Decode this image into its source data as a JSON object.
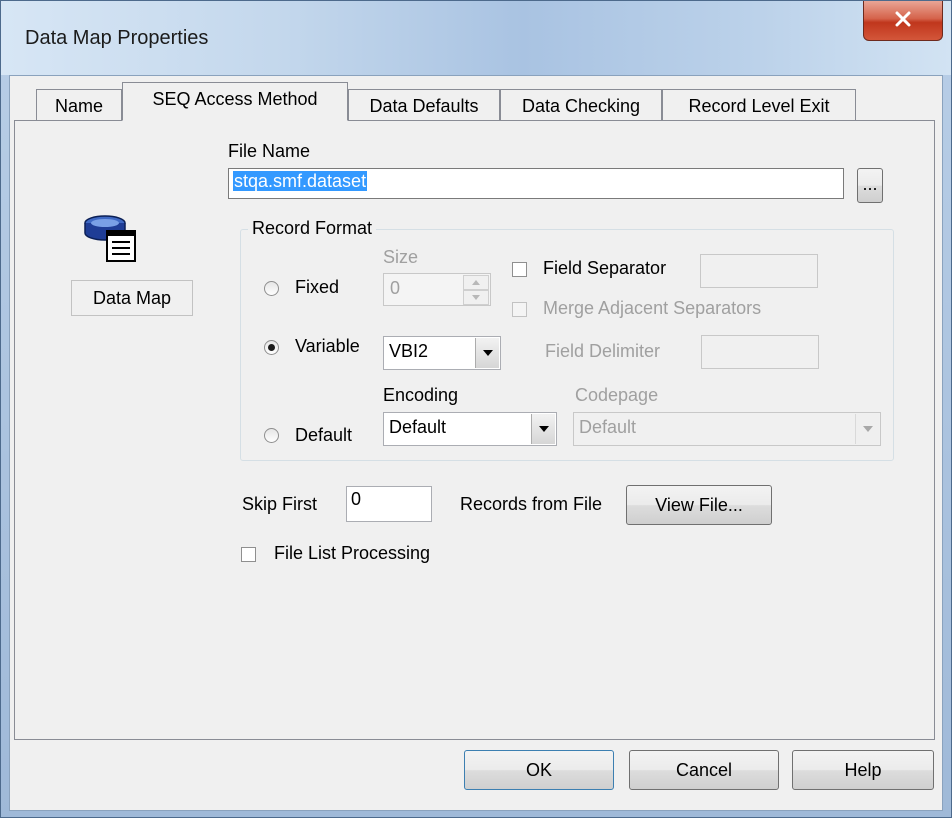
{
  "window": {
    "title": "Data Map Properties"
  },
  "tabs": [
    {
      "label": "Name"
    },
    {
      "label": "SEQ Access Method"
    },
    {
      "label": "Data Defaults"
    },
    {
      "label": "Data Checking"
    },
    {
      "label": "Record Level Exit"
    }
  ],
  "icon_panel": {
    "label": "Data Map"
  },
  "file_name": {
    "label": "File Name",
    "value": "stqa.smf.dataset",
    "browse_label": "..."
  },
  "record_format": {
    "title": "Record Format",
    "fixed_label": "Fixed",
    "variable_label": "Variable",
    "default_label": "Default",
    "selected": "Variable",
    "size_label": "Size",
    "size_value": "0",
    "variable_value": "VBI2",
    "field_separator_label": "Field Separator",
    "field_separator_value": "",
    "merge_label": "Merge Adjacent Separators",
    "field_delimiter_label": "Field Delimiter",
    "field_delimiter_value": "",
    "encoding_label": "Encoding",
    "encoding_value": "Default",
    "codepage_label": "Codepage",
    "codepage_value": "Default"
  },
  "skip": {
    "label_before": "Skip First",
    "value": "0",
    "label_after": "Records from File",
    "view_button": "View File..."
  },
  "file_list_processing": {
    "label": "File List Processing",
    "checked": false
  },
  "buttons": {
    "ok": "OK",
    "cancel": "Cancel",
    "help": "Help"
  },
  "colors": {
    "selection": "#3399ff",
    "close_button": "#c9452a",
    "dialog_face": "#f0f0f0"
  }
}
